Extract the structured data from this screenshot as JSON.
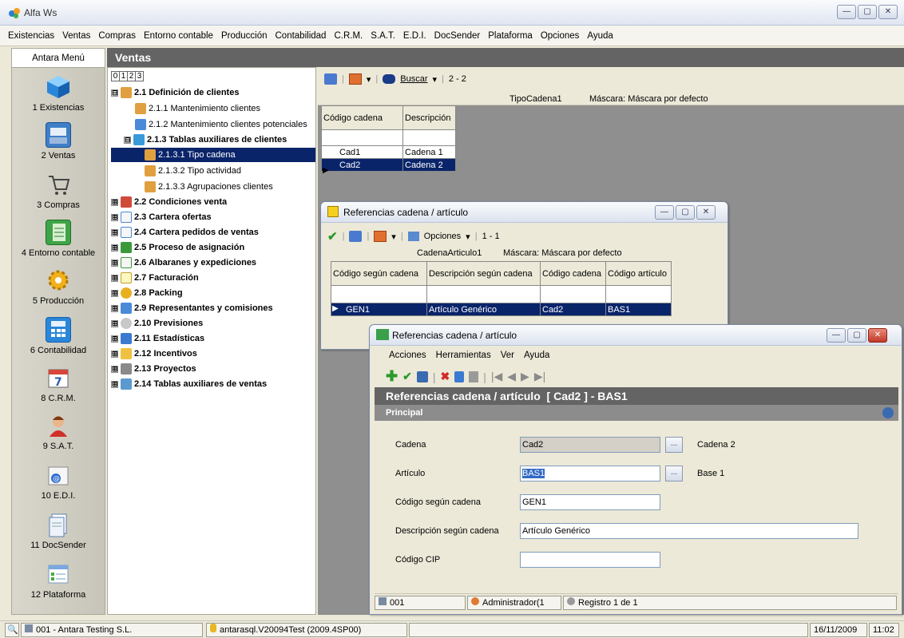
{
  "app": {
    "title": "Alfa Ws"
  },
  "menu": [
    "Existencias",
    "Ventas",
    "Compras",
    "Entorno contable",
    "Producción",
    "Contabilidad",
    "C.R.M.",
    "S.A.T.",
    "E.D.I.",
    "DocSender",
    "Plataforma",
    "Opciones",
    "Ayuda"
  ],
  "sidebar": {
    "header": "Antara Menú",
    "items": [
      {
        "label": "1 Existencias",
        "icon": "cube-icon"
      },
      {
        "label": "2 Ventas",
        "icon": "cash-register-icon"
      },
      {
        "label": "3 Compras",
        "icon": "cart-icon"
      },
      {
        "label": "4 Entorno contable",
        "icon": "ledger-icon"
      },
      {
        "label": "5 Producción",
        "icon": "gear-icon"
      },
      {
        "label": "6 Contabilidad",
        "icon": "calculator-icon"
      },
      {
        "label": "8 C.R.M.",
        "icon": "calendar-icon"
      },
      {
        "label": "9 S.A.T.",
        "icon": "support-agent-icon"
      },
      {
        "label": "10 E.D.I.",
        "icon": "edi-mail-icon"
      },
      {
        "label": "11 DocSender",
        "icon": "document-icon"
      },
      {
        "label": "12 Plataforma",
        "icon": "checklist-icon"
      }
    ]
  },
  "section": {
    "title": "Ventas"
  },
  "tree": {
    "tabs": [
      "0",
      "1",
      "2",
      "3"
    ],
    "nodes": [
      {
        "label": "2.1 Definición de clientes",
        "bold": true,
        "expander": "⊟"
      },
      {
        "label": "2.1.1 Mantenimiento clientes"
      },
      {
        "label": "2.1.2 Mantenimiento clientes potenciales"
      },
      {
        "label": "2.1.3 Tablas auxiliares de clientes",
        "bold": true,
        "expander": "⊟"
      },
      {
        "label": "2.1.3.1 Tipo cadena",
        "selected": true
      },
      {
        "label": "2.1.3.2 Tipo actividad"
      },
      {
        "label": "2.1.3.3 Agrupaciones clientes"
      },
      {
        "label": "2.2 Condiciones venta",
        "bold": true,
        "expander": "⊞"
      },
      {
        "label": "2.3 Cartera ofertas",
        "bold": true,
        "expander": "⊞"
      },
      {
        "label": "2.4 Cartera pedidos de ventas",
        "bold": true,
        "expander": "⊞"
      },
      {
        "label": "2.5 Proceso de asignación",
        "bold": true,
        "expander": "⊞"
      },
      {
        "label": "2.6 Albaranes y expediciones",
        "bold": true,
        "expander": "⊞"
      },
      {
        "label": "2.7 Facturación",
        "bold": true,
        "expander": "⊞"
      },
      {
        "label": "2.8 Packing",
        "bold": true,
        "expander": "⊞"
      },
      {
        "label": "2.9 Representantes y comisiones",
        "bold": true,
        "expander": "⊞"
      },
      {
        "label": "2.10 Previsiones",
        "bold": true,
        "expander": "⊞"
      },
      {
        "label": "2.11 Estadísticas",
        "bold": true,
        "expander": "⊞"
      },
      {
        "label": "2.12 Incentivos",
        "bold": true,
        "expander": "⊞"
      },
      {
        "label": "2.13 Proyectos",
        "bold": true,
        "expander": "⊞"
      },
      {
        "label": "2.14 Tablas auxiliares de ventas",
        "bold": true,
        "expander": "⊞"
      }
    ]
  },
  "tipocadena": {
    "search_label": "Buscar",
    "count": "2 - 2",
    "grid_name": "TipoCadena1",
    "mask": "Máscara: Máscara por defecto",
    "headers": [
      "Código cadena",
      "Descripción"
    ],
    "rows": [
      [
        "Cad1",
        "Cadena 1"
      ],
      [
        "Cad2",
        "Cadena 2"
      ]
    ]
  },
  "refwin1": {
    "title": "Referencias cadena / artículo",
    "options_label": "Opciones",
    "count": "1 - 1",
    "grid_name": "CadenaArticulo1",
    "mask": "Máscara: Máscara por defecto",
    "headers": [
      "Código según cadena",
      "Descripción según cadena",
      "Código cadena",
      "Código artículo"
    ],
    "row": [
      "GEN1",
      "Artículo Genérico",
      "Cad2",
      "BAS1"
    ]
  },
  "refwin2": {
    "title": "Referencias cadena / artículo",
    "menu": [
      "Acciones",
      "Herramientas",
      "Ver",
      "Ayuda"
    ],
    "heading": "Referencias cadena / artículo  [ Cad2 ] - BAS1",
    "section": "Principal",
    "fields": {
      "cadena_label": "Cadena",
      "cadena_value": "Cad2",
      "cadena_desc": "Cadena 2",
      "articulo_label": "Artículo",
      "articulo_value": "BAS1",
      "articulo_desc": "Base 1",
      "codigo_label": "Código según cadena",
      "codigo_value": "GEN1",
      "descripcion_label": "Descripción según cadena",
      "descripcion_value": "Artículo Genérico",
      "cip_label": "Código CIP",
      "cip_value": ""
    },
    "status": {
      "company": "001",
      "user": "Administrador(1",
      "record": "Registro 1 de 1"
    }
  },
  "statusbar": {
    "company": "001 - Antara Testing S.L.",
    "db": "antarasql.V20094Test (2009.4SP00)",
    "date": "16/11/2009",
    "time": "11:02"
  }
}
